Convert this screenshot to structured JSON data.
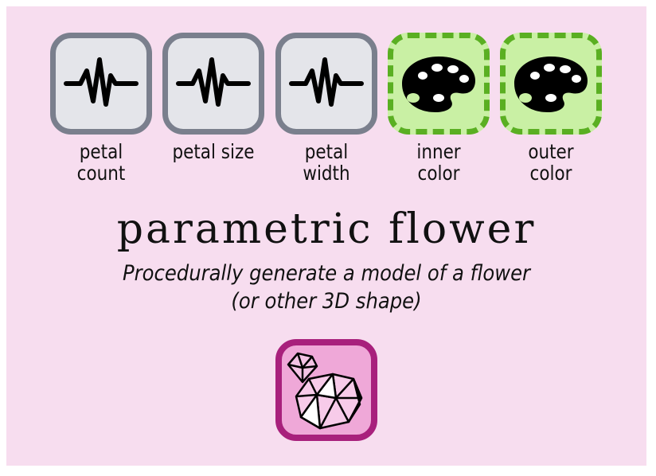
{
  "inputs": [
    {
      "label_line1": "petal",
      "label_line2": "count",
      "kind": "number",
      "icon": "waveform-icon"
    },
    {
      "label_line1": "petal size",
      "label_line2": "",
      "kind": "number",
      "icon": "waveform-icon"
    },
    {
      "label_line1": "petal",
      "label_line2": "width",
      "kind": "number",
      "icon": "waveform-icon"
    },
    {
      "label_line1": "inner",
      "label_line2": "color",
      "kind": "color",
      "icon": "palette-icon"
    },
    {
      "label_line1": "outer",
      "label_line2": "color",
      "kind": "color",
      "icon": "palette-icon"
    }
  ],
  "title": "parametric flower",
  "description": {
    "line1": "Procedurally generate a model of a flower",
    "line2": "(or other 3D shape)"
  },
  "output": {
    "icon": "gem-icon"
  },
  "colors": {
    "background": "#f7ddef",
    "number_tile_bg": "#e4e5ea",
    "number_tile_border": "#7a7f8d",
    "color_tile_bg": "#c9f0a4",
    "color_tile_border": "#5aaf22",
    "output_tile_bg": "#efa8d8",
    "output_tile_border": "#a8207c"
  }
}
